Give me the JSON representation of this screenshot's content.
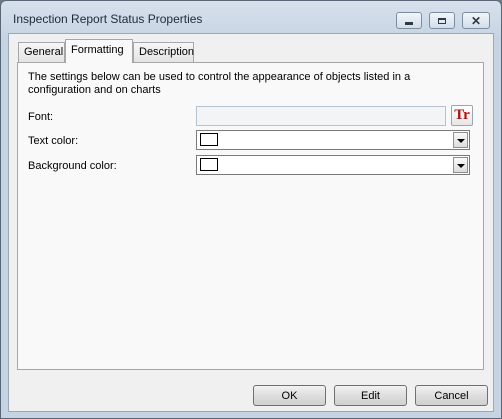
{
  "window": {
    "title": "Inspection Report Status Properties",
    "controls": {
      "minimize": "minimize-icon",
      "maximize": "maximize-icon",
      "close": "close-icon"
    }
  },
  "tabs": [
    {
      "label": "General",
      "selected": false
    },
    {
      "label": "Formatting",
      "selected": true
    },
    {
      "label": "Description",
      "selected": false
    }
  ],
  "formatting": {
    "intro": "The settings below can be used to control the appearance of objects listed in a configuration and on charts",
    "font_label": "Font:",
    "font_value": "",
    "text_color_label": "Text color:",
    "text_color_value": "#ffffff",
    "background_color_label": "Background color:",
    "background_color_value": "#ffffff"
  },
  "buttons": {
    "ok": "OK",
    "edit": "Edit",
    "cancel": "Cancel"
  }
}
